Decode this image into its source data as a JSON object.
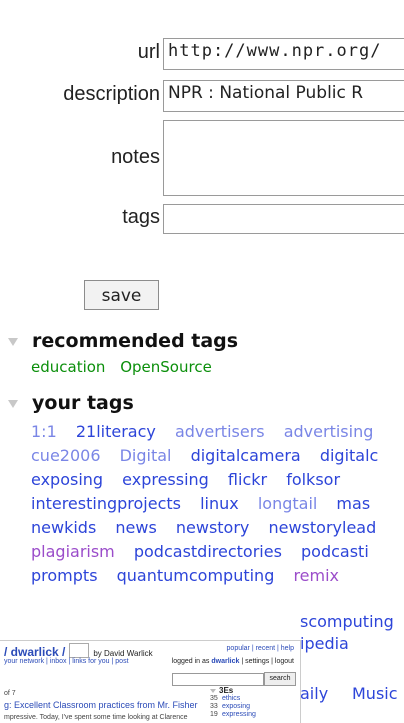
{
  "form": {
    "url_label": "url",
    "url_value": "http://www.npr.org/",
    "description_label": "description",
    "description_value": "NPR : National Public R",
    "notes_label": "notes",
    "notes_value": "",
    "tags_label": "tags",
    "tags_value": "",
    "save_label": "save"
  },
  "recommended": {
    "heading": "recommended tags",
    "tags": [
      "education",
      "OpenSource"
    ]
  },
  "your_tags": {
    "heading": "your tags",
    "lines": [
      [
        "1:1",
        "21literacy",
        "advertisers",
        "advertising"
      ],
      [
        "cue2006",
        "Digital",
        "digitalcamera",
        "digitalc"
      ],
      [
        "exposing",
        "expressing",
        "flickr",
        "folksor"
      ],
      [
        "interestingprojects",
        "linux",
        "longtail",
        "mas"
      ],
      [
        "newkids",
        "news",
        "newstory",
        "newstorylead"
      ],
      [
        "plagiarism",
        "podcastdirectories",
        "podcasti"
      ],
      [
        "prompts",
        "quantumcomputing",
        "remix"
      ]
    ],
    "partial_right": [
      "scomputing",
      "ipedia",
      "aily",
      "Music"
    ]
  },
  "inset": {
    "title": "/ dwarlick /",
    "by": "by David Warlick",
    "top_links": "popular | recent | help",
    "nav": "your network | inbox | links for you | post",
    "login_prefix": "logged in as",
    "login_user": "dwarlick",
    "login_links": "| settings | logout",
    "search_button": "search",
    "of_text": "of 7",
    "post_title": "g: Excellent Classroom practices from Mr. Fisher",
    "post_desc": "mpressive. Today, I've spent some time looking at Clarence",
    "bundle_name": "3Es",
    "bundle_items": [
      {
        "count": "35",
        "tag": "ethics"
      },
      {
        "count": "33",
        "tag": "exposing"
      },
      {
        "count": "19",
        "tag": "expressing"
      }
    ]
  }
}
